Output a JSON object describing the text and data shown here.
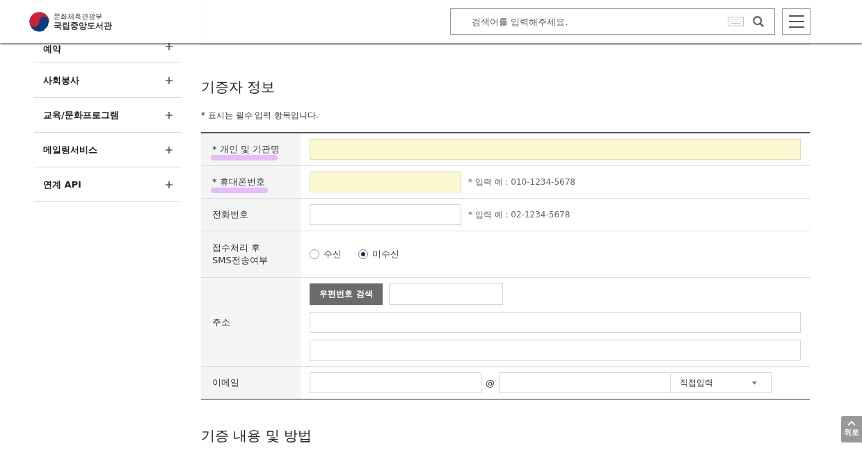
{
  "header": {
    "ministry": "문화체육관광부",
    "library": "국립중앙도서관",
    "search": {
      "placeholder": "검색어를 입력해주세요."
    }
  },
  "sidebar": {
    "items": [
      {
        "label": "예약"
      },
      {
        "label": "사회봉사"
      },
      {
        "label": "교육/문화프로그램"
      },
      {
        "label": "메일링서비스"
      },
      {
        "label": "연계 API"
      }
    ]
  },
  "donor_section": {
    "title": "기증자 정보",
    "note": "* 표시는 필수 입력 항목입니다.",
    "rows": [
      {
        "kind": "text",
        "label": "* 개인 및 기관명",
        "marked": true,
        "required": true
      },
      {
        "kind": "phone",
        "label": "* 휴대폰번호",
        "marked": true,
        "required": true,
        "hint": "* 입력 예 : 010-1234-5678"
      },
      {
        "kind": "phone",
        "label": "전화번호",
        "marked": false,
        "required": false,
        "hint": "* 입력 예 : 02-1234-5678"
      },
      {
        "kind": "radio",
        "label": "접수처리 후\nSMS전송여부",
        "marked": false,
        "options": [
          {
            "label": "수신",
            "selected": false
          },
          {
            "label": "미수신",
            "selected": true
          }
        ]
      },
      {
        "kind": "address",
        "label": "주소",
        "marked": false,
        "button": "우편번호 검색"
      },
      {
        "kind": "email",
        "label": "이메일",
        "marked": false,
        "at": "@",
        "domain_select": "직접입력"
      }
    ]
  },
  "next_section": {
    "title": "기증 내용 및 방법"
  },
  "top_button": "위로"
}
